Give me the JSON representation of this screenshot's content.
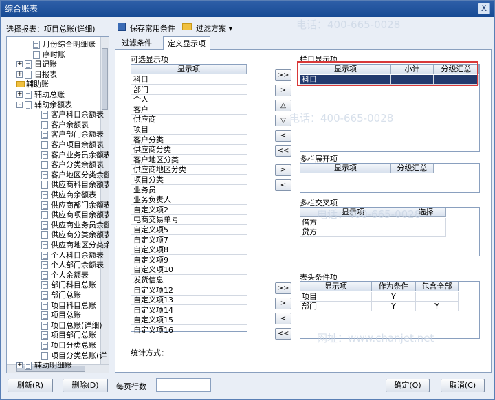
{
  "window": {
    "title": "综合账表",
    "close_label": "X"
  },
  "left": {
    "report_label": "选择报表：",
    "report_value": "项目总账(详细)"
  },
  "tree": [
    {
      "label": "月份综合明细账",
      "depth": 2,
      "icon": "doc"
    },
    {
      "label": "序时账",
      "depth": 2,
      "icon": "doc"
    },
    {
      "label": "日记账",
      "depth": 1,
      "toggle": "+",
      "icon": "doc"
    },
    {
      "label": "日报表",
      "depth": 1,
      "toggle": "+",
      "icon": "doc"
    },
    {
      "label": "辅助账",
      "depth": 0,
      "icon": "folder"
    },
    {
      "label": "辅助总账",
      "depth": 1,
      "toggle": "+",
      "icon": "doc"
    },
    {
      "label": "辅助余额表",
      "depth": 1,
      "toggle": "-",
      "icon": "doc"
    },
    {
      "label": "客户科目余额表",
      "depth": 3,
      "icon": "doc"
    },
    {
      "label": "客户余额表",
      "depth": 3,
      "icon": "doc"
    },
    {
      "label": "客户部门余额表",
      "depth": 3,
      "icon": "doc"
    },
    {
      "label": "客户项目余额表",
      "depth": 3,
      "icon": "doc"
    },
    {
      "label": "客户业务员余额表",
      "depth": 3,
      "icon": "doc"
    },
    {
      "label": "客户分类余额表",
      "depth": 3,
      "icon": "doc"
    },
    {
      "label": "客户地区分类余额",
      "depth": 3,
      "icon": "doc"
    },
    {
      "label": "供应商科目余额表",
      "depth": 3,
      "icon": "doc"
    },
    {
      "label": "供应商余额表",
      "depth": 3,
      "icon": "doc"
    },
    {
      "label": "供应商部门余额表",
      "depth": 3,
      "icon": "doc"
    },
    {
      "label": "供应商项目余额表",
      "depth": 3,
      "icon": "doc"
    },
    {
      "label": "供应商业务员余额",
      "depth": 3,
      "icon": "doc"
    },
    {
      "label": "供应商分类余额表",
      "depth": 3,
      "icon": "doc"
    },
    {
      "label": "供应商地区分类余",
      "depth": 3,
      "icon": "doc"
    },
    {
      "label": "个人科目余额表",
      "depth": 3,
      "icon": "doc"
    },
    {
      "label": "个人部门余额表",
      "depth": 3,
      "icon": "doc"
    },
    {
      "label": "个人余额表",
      "depth": 3,
      "icon": "doc"
    },
    {
      "label": "部门科目总账",
      "depth": 3,
      "icon": "doc"
    },
    {
      "label": "部门总账",
      "depth": 3,
      "icon": "doc"
    },
    {
      "label": "项目科目总账",
      "depth": 3,
      "icon": "doc"
    },
    {
      "label": "项目总账",
      "depth": 3,
      "icon": "doc"
    },
    {
      "label": "项目总账(详细)",
      "depth": 3,
      "icon": "doc"
    },
    {
      "label": "项目部门总账",
      "depth": 3,
      "icon": "doc"
    },
    {
      "label": "项目分类总账",
      "depth": 3,
      "icon": "doc"
    },
    {
      "label": "项目分类总账(详",
      "depth": 3,
      "icon": "doc"
    },
    {
      "label": "辅助明细账",
      "depth": 1,
      "toggle": "+",
      "icon": "doc"
    }
  ],
  "toolbar": {
    "save_label": "保存常用条件",
    "filter_label": "过滤方案",
    "filter_arrow": "▾"
  },
  "tabs": [
    {
      "label": "过滤条件"
    },
    {
      "label": "定义显示项"
    }
  ],
  "available": {
    "title": "可选显示项",
    "header": "显示项",
    "items": [
      "科目",
      "部门",
      "个人",
      "客户",
      "供应商",
      "项目",
      "客户分类",
      "供应商分类",
      "客户地区分类",
      "供应商地区分类",
      "项目分类",
      "业务员",
      "业务负责人",
      "自定义项2",
      "电商交易单号",
      "自定义项5",
      "自定义项7",
      "自定义项8",
      "自定义项9",
      "自定义项10",
      "发货信息",
      "自定义项12",
      "自定义项13",
      "自定义项14",
      "自定义项15",
      "自定义项16"
    ]
  },
  "move_buttons": {
    "all_right": ">>",
    "right": ">",
    "up": "△",
    "down": "▽",
    "left": "<",
    "all_left": "<<"
  },
  "column_display": {
    "title": "栏目显示项",
    "headers": [
      "显示项",
      "小计",
      "分级汇总"
    ],
    "rows": [
      [
        "科目",
        "",
        ""
      ]
    ]
  },
  "multi_expand": {
    "title": "多栏展开项",
    "headers": [
      "显示项",
      "分级汇总"
    ]
  },
  "multi_cross": {
    "title": "多栏交叉项",
    "headers": [
      "显示项",
      "选择"
    ],
    "rows": [
      [
        "借方",
        ""
      ],
      [
        "贷方",
        ""
      ]
    ]
  },
  "header_cond": {
    "title": "表头条件项",
    "headers": [
      "显示项",
      "作为条件",
      "包含全部"
    ],
    "rows": [
      [
        "项目",
        "Y",
        ""
      ],
      [
        "部门",
        "Y",
        "Y"
      ]
    ]
  },
  "stat_label": "统计方式：",
  "bottom": {
    "refresh_label": "刷新(R)",
    "delete_label": "删除(D)",
    "rows_per_page_label": "每页行数",
    "ok_label": "确定(O)",
    "cancel_label": "取消(C)"
  },
  "watermark": {
    "phone": "电话：400-665-0028",
    "url": "网址：www.chanjet.net"
  },
  "colors": {
    "title_bar": "#1f55a0",
    "selection": "#223a6e",
    "highlight_border": "#d93838"
  }
}
